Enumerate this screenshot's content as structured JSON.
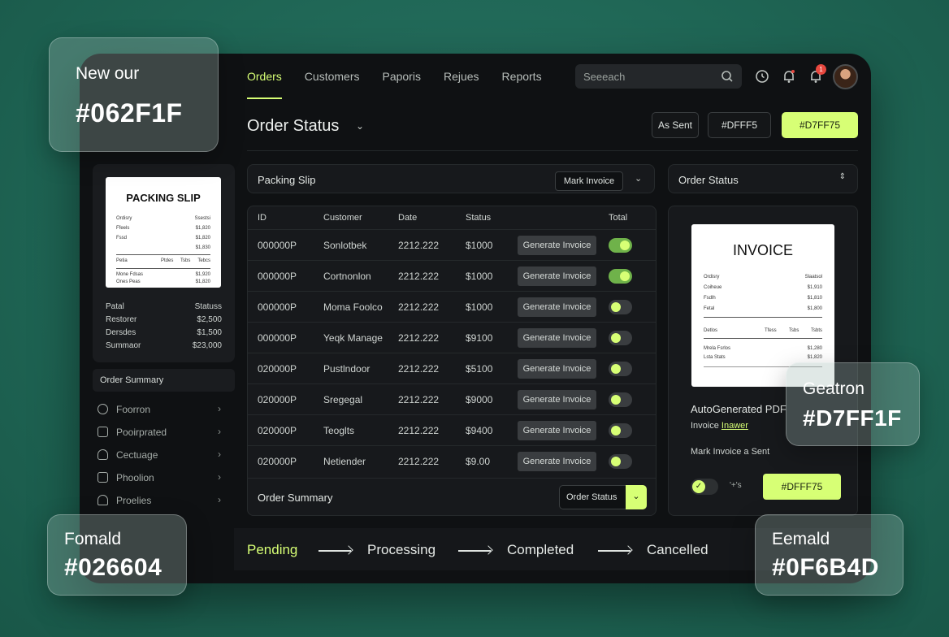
{
  "colors": {
    "accent": "#d7ff75",
    "background": "#1f6655",
    "app_bg": "#0f1113",
    "toggle_on": "#6fb24a",
    "badge": "#e8483f"
  },
  "nav": {
    "tabs": [
      "Orders",
      "Customers",
      "Paporis",
      "Rejues",
      "Reports"
    ],
    "active_tab": "Orders",
    "search_placeholder": "Seeeach",
    "notification_count": "1",
    "icons": [
      "search-icon",
      "clock-icon",
      "bell-icon",
      "bell-icon",
      "avatar"
    ]
  },
  "header": {
    "title": "Order Status",
    "btn_sent": "As Sent",
    "btn_color1": "#DFFF5",
    "btn_color2": "#D7FF75"
  },
  "sidebar": {
    "slip": {
      "title": "PACKING SLIP",
      "left_col": [
        "Ordisry",
        "Ffeels",
        "Fssd"
      ],
      "right_col": [
        "Ssestsi",
        "$1,820",
        "$1,820",
        "$1,830"
      ],
      "mid_labels": [
        "Petia",
        "Ptdes",
        "Tsbs",
        "Tebcs"
      ],
      "foot_left": [
        "Mone Fdsas",
        "Ones Peas"
      ],
      "foot_right": [
        "$1,920",
        "$1,820"
      ]
    },
    "totals": [
      {
        "label": "Patal",
        "value": "Statuss"
      },
      {
        "label": "Restorer",
        "value": "$2,500"
      },
      {
        "label": "Dersdes",
        "value": "$1,500"
      },
      {
        "label": "Summaor",
        "value": "$23,000"
      }
    ],
    "summary_label": "Order Summary",
    "items": [
      {
        "label": "Foorron",
        "icon": "chat-icon"
      },
      {
        "label": "Pooirprated",
        "icon": "card-icon"
      },
      {
        "label": "Cectuage",
        "icon": "package-icon"
      },
      {
        "label": "Phoolion",
        "icon": "inbox-icon"
      },
      {
        "label": "Proelies",
        "icon": "home-icon"
      }
    ]
  },
  "packing": {
    "title": "Packing Slip",
    "mark_label": "Mark Invoice"
  },
  "table": {
    "columns": [
      "ID",
      "Customer",
      "Date",
      "Status",
      "Total"
    ],
    "action_label": "Generate Invoice",
    "rows": [
      {
        "id": "000000P",
        "customer": "Sonlotbek",
        "date": "2212.222",
        "status": "$1000",
        "on": true
      },
      {
        "id": "000000P",
        "customer": "Cortnonlon",
        "date": "2212.222",
        "status": "$1000",
        "on": true
      },
      {
        "id": "000000P",
        "customer": "Moma Foolco",
        "date": "2212.222",
        "status": "$1000",
        "on": false
      },
      {
        "id": "000000P",
        "customer": "Yeqk Manage",
        "date": "2212.222",
        "status": "$9100",
        "on": false
      },
      {
        "id": "020000P",
        "customer": "Pustlndoor",
        "date": "2212.222",
        "status": "$5100",
        "on": false
      },
      {
        "id": "020000P",
        "customer": "Sregegal",
        "date": "2212.222",
        "status": "$9000",
        "on": false
      },
      {
        "id": "020000P",
        "customer": "Teoglts",
        "date": "2212.222",
        "status": "$9400",
        "on": false
      },
      {
        "id": "020000P",
        "customer": "Netiender",
        "date": "2212.222",
        "status": "$9.00",
        "on": false
      }
    ],
    "footer_label": "Order Summary",
    "footer_btn": "Order Status"
  },
  "right_panel": {
    "title": "Order Status",
    "invoice": {
      "title": "INVOICE",
      "left_col": [
        "Ordisry",
        "Coiheue",
        "Fsdlh",
        "Fetal"
      ],
      "right_col": [
        "Slaatsol",
        "$1,910",
        "$1,810",
        "$1,800"
      ],
      "mid_labels": [
        "Detlos",
        "Tfess",
        "Tsbs",
        "Tsbts"
      ],
      "foot_left": [
        "Mrela Fsrlos",
        "Lsta Stats"
      ],
      "foot_right": [
        "$1,280",
        "$1,820"
      ]
    },
    "autogen": "AutoGenerated PDF",
    "invoice_link_prefix": "Invoice",
    "invoice_link": "Inawer",
    "mark_sent": "Mark Invoice a Sent",
    "toggle_text": "'+'s",
    "color_btn": "#DFFF75"
  },
  "status_flow": [
    "Pending",
    "Processing",
    "Completed",
    "Cancelled"
  ],
  "swatches": [
    {
      "name": "New our",
      "hex": "#062F1F"
    },
    {
      "name": "Geatron",
      "hex": "#D7FF1F"
    },
    {
      "name": "Fomald",
      "hex": "#026604"
    },
    {
      "name": "Eemald",
      "hex": "#0F6B4D"
    }
  ]
}
